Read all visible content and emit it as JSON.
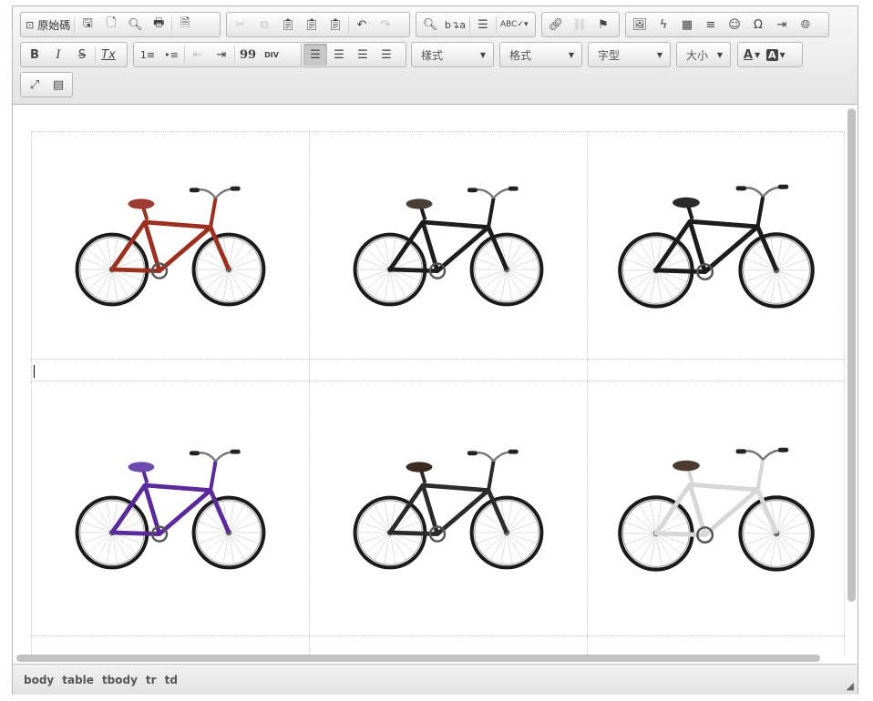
{
  "toolbar": {
    "source_label": "原始碼",
    "style_label": "樣式",
    "format_label": "格式",
    "font_label": "字型",
    "size_label": "大小",
    "text_color_icon": "A",
    "bg_color_icon": "A"
  },
  "icons": {
    "bold": "B",
    "italic": "I",
    "strike": "S",
    "removeformat": "Tx",
    "quote": "99",
    "div": "DIV",
    "special_char": "Ω",
    "smiley": "☺",
    "undo": "↶",
    "redo": "↷"
  },
  "content": {
    "rows": [
      [
        {
          "name": "red-cruiser-bike",
          "frame": "#9b2f20",
          "seat": "#9e3b34"
        },
        {
          "name": "black-cruiser-bike",
          "frame": "#1d1d1d",
          "seat": "#4a4038"
        },
        {
          "name": "black-mountain-bike",
          "frame": "#1c1c1c",
          "seat": "#2a2a2a"
        }
      ],
      [
        {
          "name": "purple-cruiser-bike",
          "frame": "#5a2a9a",
          "seat": "#6d4aae"
        },
        {
          "name": "black-dutch-bike",
          "frame": "#2b2b2b",
          "seat": "#3b2a22"
        },
        {
          "name": "white-city-bike",
          "frame": "#d7d7d7",
          "seat": "#4a3a30"
        }
      ]
    ]
  },
  "footer": {
    "path": [
      "body",
      "table",
      "tbody",
      "tr",
      "td"
    ]
  }
}
